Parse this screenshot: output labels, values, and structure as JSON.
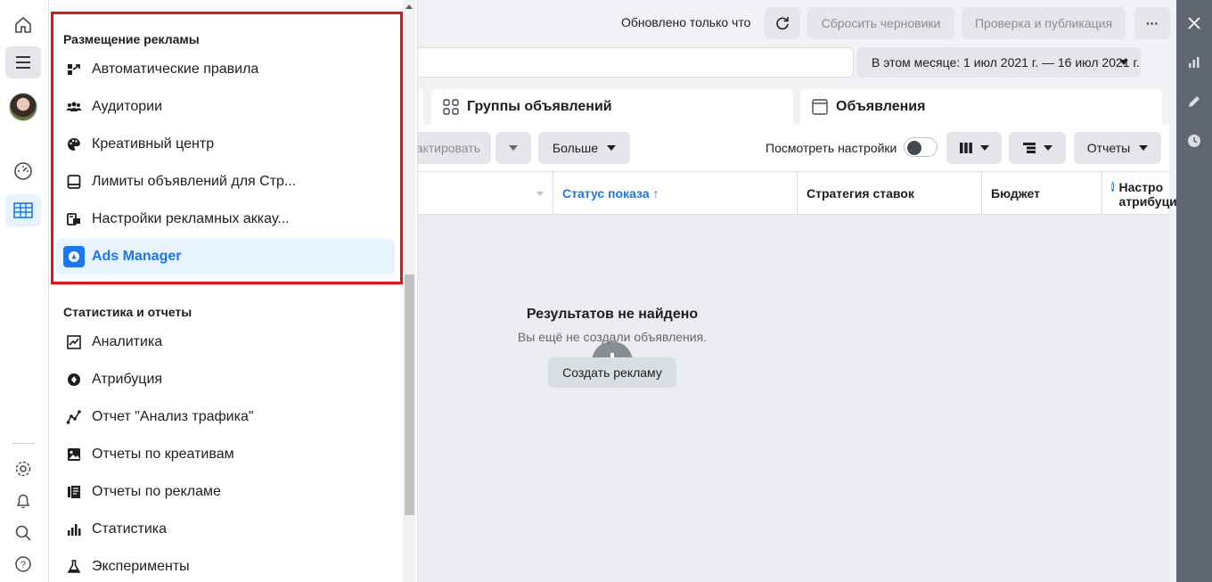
{
  "menu": {
    "section1_title": "Размещение рекламы",
    "section1_items": [
      {
        "label": "Автоматические правила",
        "icon": "rules-icon"
      },
      {
        "label": "Аудитории",
        "icon": "audience-icon"
      },
      {
        "label": "Креативный центр",
        "icon": "palette-icon"
      },
      {
        "label": "Лимиты объявлений для Стр...",
        "icon": "tablet-icon"
      },
      {
        "label": "Настройки рекламных аккау...",
        "icon": "account-settings-icon"
      },
      {
        "label": "Ads Manager",
        "icon": "ads-manager-icon",
        "selected": true
      }
    ],
    "section2_title": "Статистика и отчеты",
    "section2_items": [
      {
        "label": "Аналитика",
        "icon": "analytics-icon"
      },
      {
        "label": "Атрибуция",
        "icon": "attribution-icon"
      },
      {
        "label": "Отчет \"Анализ трафика\"",
        "icon": "traffic-icon"
      },
      {
        "label": "Отчеты по креативам",
        "icon": "image-icon"
      },
      {
        "label": "Отчеты по рекламе",
        "icon": "report-icon"
      },
      {
        "label": "Статистика",
        "icon": "bar-chart-icon"
      },
      {
        "label": "Эксперименты",
        "icon": "flask-icon"
      }
    ]
  },
  "topbar": {
    "updated": "Обновлено только что",
    "reset_drafts": "Сбросить черновики",
    "review_publish": "Проверка и публикация",
    "more": "···",
    "date_range": "В этом месяце: 1 июл 2021 г. — 16 июл 2021 г."
  },
  "tabs": {
    "adsets": "Группы объявлений",
    "ads": "Объявления"
  },
  "toolbar": {
    "edit_partial": "актировать",
    "more": "Больше",
    "view_settings": "Посмотреть настройки",
    "reports": "Отчеты"
  },
  "table": {
    "columns": [
      "Статус показа ↑",
      "Стратегия ставок",
      "Бюджет",
      "Настро\nатрибуци"
    ]
  },
  "empty": {
    "title": "Результатов не найдено",
    "subtitle": "Вы ещё не создали объявления.",
    "create_button": "Создать рекламу"
  },
  "colors": {
    "accent": "#1877f2",
    "highlight_frame": "#e8121a"
  }
}
